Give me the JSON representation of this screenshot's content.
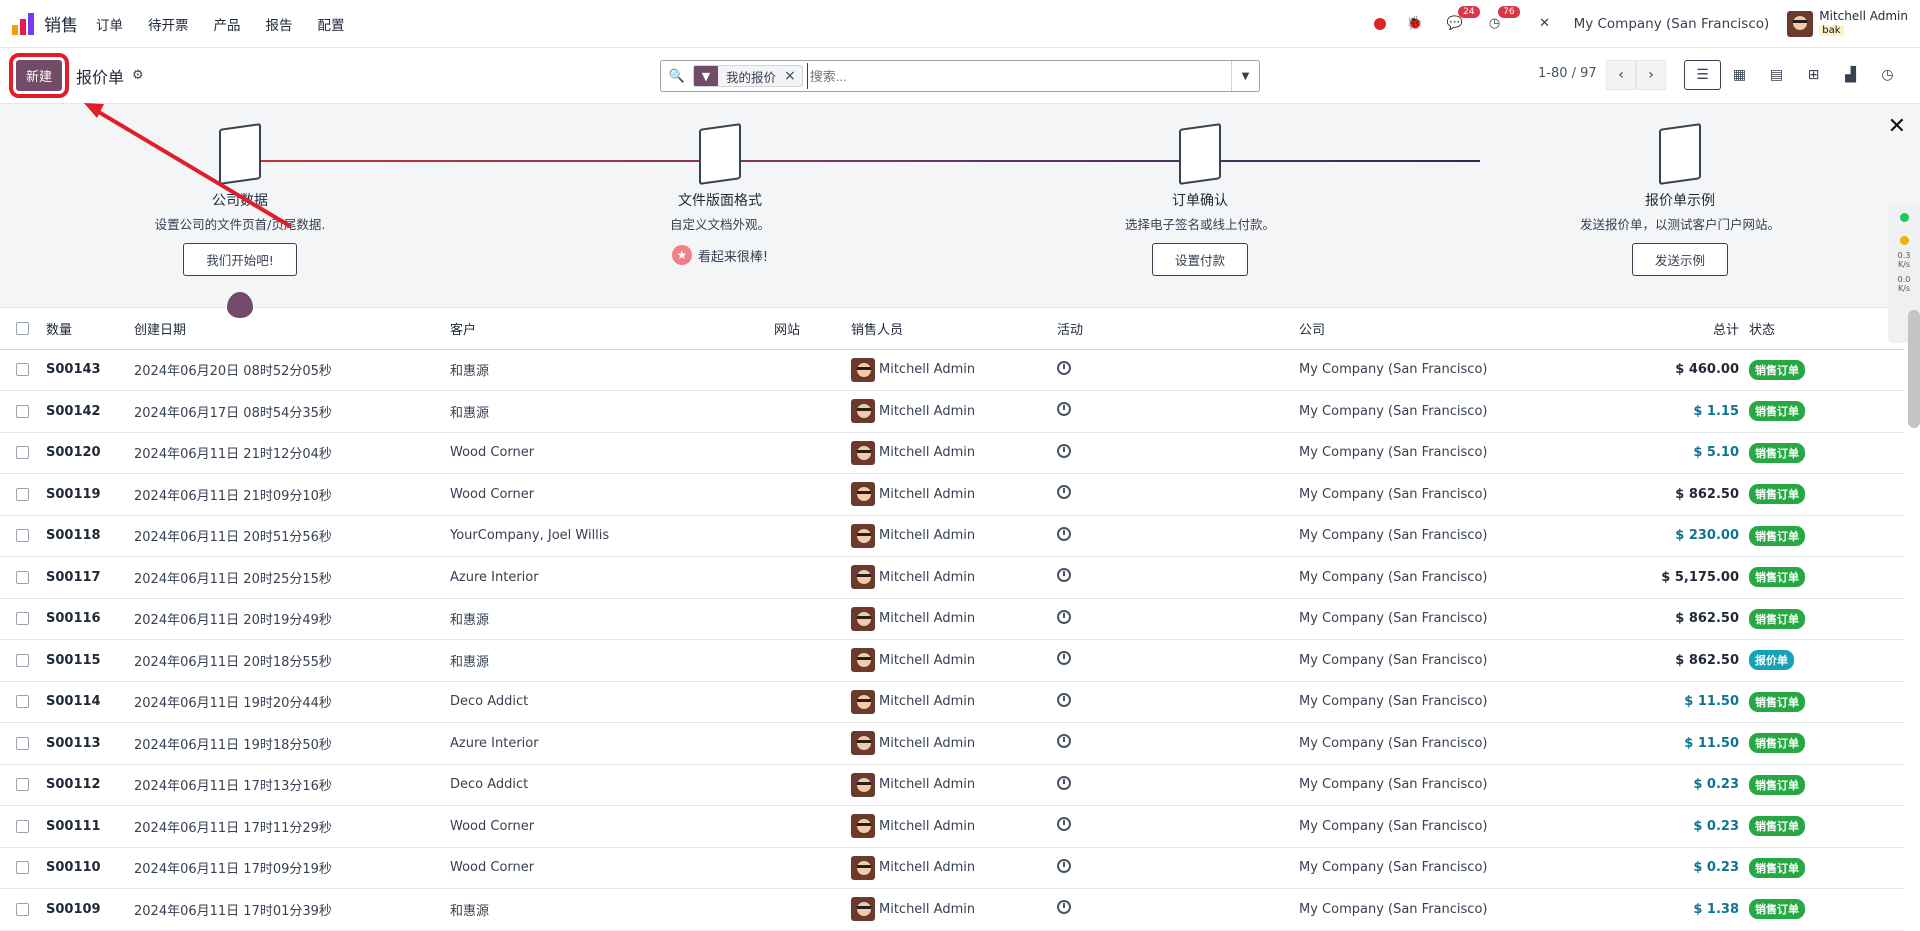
{
  "navbar": {
    "app_name": "销售",
    "menu": [
      "订单",
      "待开票",
      "产品",
      "报告",
      "配置"
    ],
    "messages_badge": "24",
    "activities_badge": "76",
    "company": "My Company (San Francisco)",
    "user_name": "Mitchell Admin",
    "user_db": "bak"
  },
  "control": {
    "new_button": "新建",
    "title": "报价单",
    "facet_label": "我的报价",
    "search_placeholder": "搜索...",
    "pager": "1-80 / 97"
  },
  "onboarding": {
    "steps": [
      {
        "title": "公司数据",
        "desc": "设置公司的文件页首/页尾数据.",
        "button": "我们开始吧!"
      },
      {
        "title": "文件版面格式",
        "desc": "自定义文档外观。",
        "done": "看起来很棒!"
      },
      {
        "title": "订单确认",
        "desc": "选择电子签名或线上付款。",
        "button": "设置付款"
      },
      {
        "title": "报价单示例",
        "desc": "发送报价单，以测试客户门户网站。",
        "button": "发送示例"
      }
    ]
  },
  "table": {
    "headers": [
      "数量",
      "创建日期",
      "客户",
      "网站",
      "销售人员",
      "活动",
      "公司",
      "总计",
      "状态"
    ],
    "rows": [
      {
        "num": "S00143",
        "date": "2024年06月20日 08时52分05秒",
        "customer": "和惠源",
        "sp": "Mitchell Admin",
        "company": "My Company (San Francisco)",
        "total": "$ 460.00",
        "tc": "dark",
        "status": "销售订单",
        "sc": "sale"
      },
      {
        "num": "S00142",
        "date": "2024年06月17日 08时54分35秒",
        "customer": "和惠源",
        "sp": "Mitchell Admin",
        "company": "My Company (San Francisco)",
        "total": "$ 1.15",
        "tc": "teal",
        "status": "销售订单",
        "sc": "sale"
      },
      {
        "num": "S00120",
        "date": "2024年06月11日 21时12分04秒",
        "customer": "Wood Corner",
        "sp": "Mitchell Admin",
        "company": "My Company (San Francisco)",
        "total": "$ 5.10",
        "tc": "teal",
        "status": "销售订单",
        "sc": "sale"
      },
      {
        "num": "S00119",
        "date": "2024年06月11日 21时09分10秒",
        "customer": "Wood Corner",
        "sp": "Mitchell Admin",
        "company": "My Company (San Francisco)",
        "total": "$ 862.50",
        "tc": "dark",
        "status": "销售订单",
        "sc": "sale"
      },
      {
        "num": "S00118",
        "date": "2024年06月11日 20时51分56秒",
        "customer": "YourCompany, Joel Willis",
        "sp": "Mitchell Admin",
        "company": "My Company (San Francisco)",
        "total": "$ 230.00",
        "tc": "teal",
        "status": "销售订单",
        "sc": "sale"
      },
      {
        "num": "S00117",
        "date": "2024年06月11日 20时25分15秒",
        "customer": "Azure Interior",
        "sp": "Mitchell Admin",
        "company": "My Company (San Francisco)",
        "total": "$ 5,175.00",
        "tc": "dark",
        "status": "销售订单",
        "sc": "sale"
      },
      {
        "num": "S00116",
        "date": "2024年06月11日 20时19分49秒",
        "customer": "和惠源",
        "sp": "Mitchell Admin",
        "company": "My Company (San Francisco)",
        "total": "$ 862.50",
        "tc": "dark",
        "status": "销售订单",
        "sc": "sale"
      },
      {
        "num": "S00115",
        "date": "2024年06月11日 20时18分55秒",
        "customer": "和惠源",
        "sp": "Mitchell Admin",
        "company": "My Company (San Francisco)",
        "total": "$ 862.50",
        "tc": "dark",
        "status": "报价单",
        "sc": "quote"
      },
      {
        "num": "S00114",
        "date": "2024年06月11日 19时20分44秒",
        "customer": "Deco Addict",
        "sp": "Mitchell Admin",
        "company": "My Company (San Francisco)",
        "total": "$ 11.50",
        "tc": "teal",
        "status": "销售订单",
        "sc": "sale"
      },
      {
        "num": "S00113",
        "date": "2024年06月11日 19时18分50秒",
        "customer": "Azure Interior",
        "sp": "Mitchell Admin",
        "company": "My Company (San Francisco)",
        "total": "$ 11.50",
        "tc": "teal",
        "status": "销售订单",
        "sc": "sale"
      },
      {
        "num": "S00112",
        "date": "2024年06月11日 17时13分16秒",
        "customer": "Deco Addict",
        "sp": "Mitchell Admin",
        "company": "My Company (San Francisco)",
        "total": "$ 0.23",
        "tc": "teal",
        "status": "销售订单",
        "sc": "sale"
      },
      {
        "num": "S00111",
        "date": "2024年06月11日 17时11分29秒",
        "customer": "Wood Corner",
        "sp": "Mitchell Admin",
        "company": "My Company (San Francisco)",
        "total": "$ 0.23",
        "tc": "teal",
        "status": "销售订单",
        "sc": "sale"
      },
      {
        "num": "S00110",
        "date": "2024年06月11日 17时09分19秒",
        "customer": "Wood Corner",
        "sp": "Mitchell Admin",
        "company": "My Company (San Francisco)",
        "total": "$ 0.23",
        "tc": "teal",
        "status": "销售订单",
        "sc": "sale"
      },
      {
        "num": "S00109",
        "date": "2024年06月11日 17时01分39秒",
        "customer": "和惠源",
        "sp": "Mitchell Admin",
        "company": "My Company (San Francisco)",
        "total": "$ 1.38",
        "tc": "teal",
        "status": "销售订单",
        "sc": "sale"
      }
    ]
  },
  "side_widget": {
    "up": "0.3",
    "down": "0.0",
    "unit": "K/s"
  },
  "colors": {
    "brand": "#714B67",
    "annotation": "#e11d2a",
    "sale": "#28a745",
    "quote": "#17a2b8"
  }
}
